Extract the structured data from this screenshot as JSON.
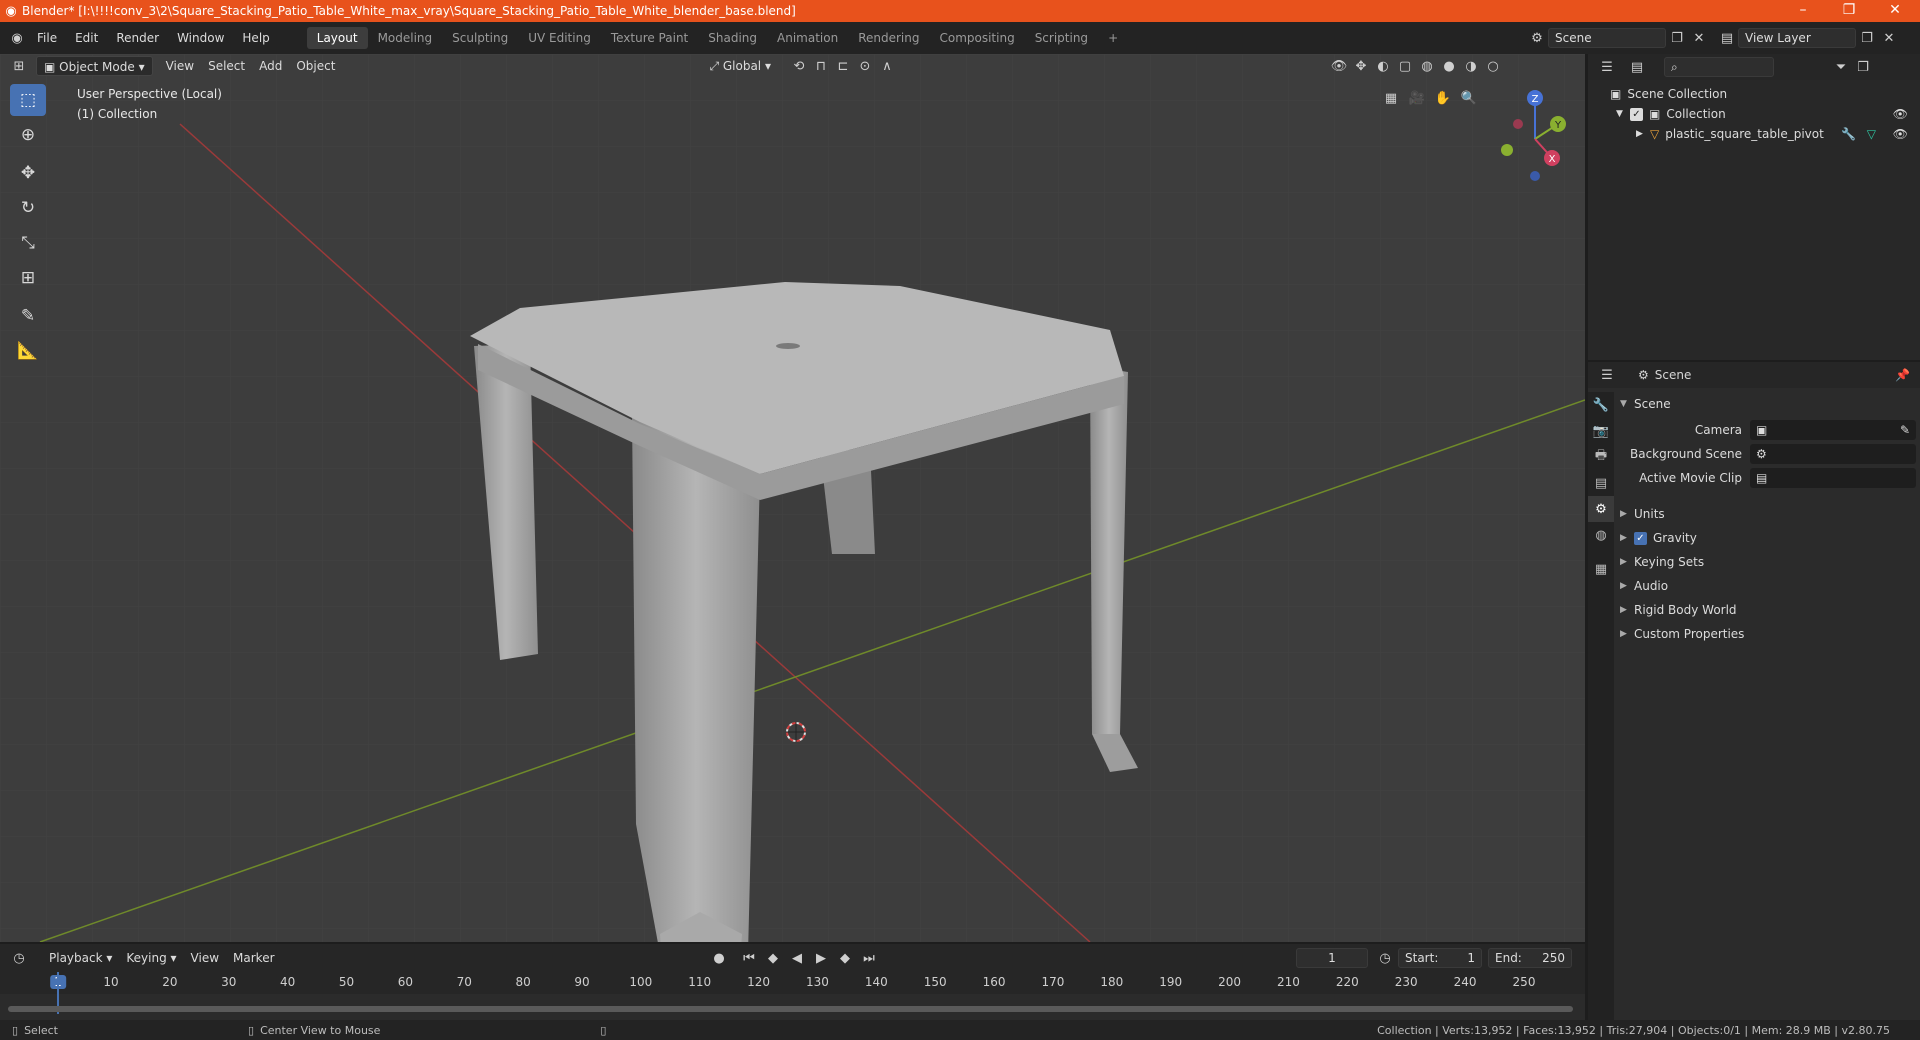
{
  "titlebar": {
    "title": "Blender* [I:\\!!!!conv_3\\2\\Square_Stacking_Patio_Table_White_max_vray\\Square_Stacking_Patio_Table_White_blender_base.blend]",
    "minimize": "–",
    "maximize": "❐",
    "close": "✕"
  },
  "menu": [
    "File",
    "Edit",
    "Render",
    "Window",
    "Help"
  ],
  "workspaces": [
    "Layout",
    "Modeling",
    "Sculpting",
    "UV Editing",
    "Texture Paint",
    "Shading",
    "Animation",
    "Rendering",
    "Compositing",
    "Scripting"
  ],
  "workspace_add": "+",
  "scene_name": "Scene",
  "view_layer": "View Layer",
  "viewport": {
    "mode": "Object Mode",
    "menus": [
      "View",
      "Select",
      "Add",
      "Object"
    ],
    "orientation": "Global",
    "info_line1": "User Perspective (Local)",
    "info_line2": "(1) Collection",
    "axis_x": "X",
    "axis_y": "Y",
    "axis_z": "Z"
  },
  "outliner": {
    "scene_collection": "Scene Collection",
    "collection": "Collection",
    "object": "plastic_square_table_pivot"
  },
  "properties": {
    "header": "Scene",
    "panel_title": "Scene",
    "camera_label": "Camera",
    "background_scene_label": "Background Scene",
    "active_movie_clip_label": "Active Movie Clip",
    "sections": [
      "Units",
      "Gravity",
      "Keying Sets",
      "Audio",
      "Rigid Body World",
      "Custom Properties"
    ]
  },
  "timeline": {
    "menus": [
      "Playback",
      "Keying",
      "View",
      "Marker"
    ],
    "current_frame": "1",
    "start_label": "Start:",
    "start": "1",
    "end_label": "End:",
    "end": "250",
    "ticks": [
      "1",
      "10",
      "20",
      "30",
      "40",
      "50",
      "60",
      "70",
      "80",
      "90",
      "100",
      "110",
      "120",
      "130",
      "140",
      "150",
      "160",
      "170",
      "180",
      "190",
      "200",
      "210",
      "220",
      "230",
      "240",
      "250"
    ]
  },
  "statusbar": {
    "left_action": "Select",
    "middle_action": "Center View to Mouse",
    "stats": "Collection | Verts:13,952 | Faces:13,952 | Tris:27,904 | Objects:0/1 | Mem: 28.9 MB | v2.80.75"
  },
  "colors": {
    "title_bar": "#e8521c",
    "accent_blue": "#4772b3",
    "x_axis": "#b04040",
    "y_axis": "#7a9a2a",
    "viewport_bg": "#3d3d3d"
  }
}
